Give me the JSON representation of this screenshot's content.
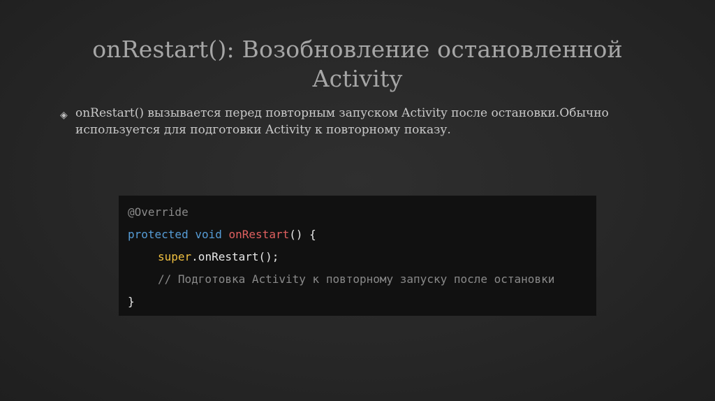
{
  "slide": {
    "title_line1": "onRestart(): Возобновление остановленной",
    "title_line2": "Activity",
    "bullet_icon": "diamond-bullet-icon",
    "bullet_text": "onRestart() вызывается перед повторным запуском Activity после остановки.Обычно\nиспользуется для подготовки Activity к повторному показу."
  },
  "code": {
    "line1": "@Override",
    "line2_kw1": "protected",
    "line2_kw2": "void",
    "line2_fn": "onRestart",
    "line2_rest": "() {",
    "line3_super": "super",
    "line3_rest": ".onRestart();",
    "line4_comment": "// Подготовка Activity к повторному запуску после остановки",
    "line5": "}"
  },
  "colors": {
    "background": "#262626",
    "title": "#a6a6a6",
    "text": "#c9c9c9",
    "code_bg": "#111111",
    "keyword": "#569cd6",
    "function": "#e06060",
    "super": "#f0c040",
    "comment": "#8a8a8a"
  }
}
